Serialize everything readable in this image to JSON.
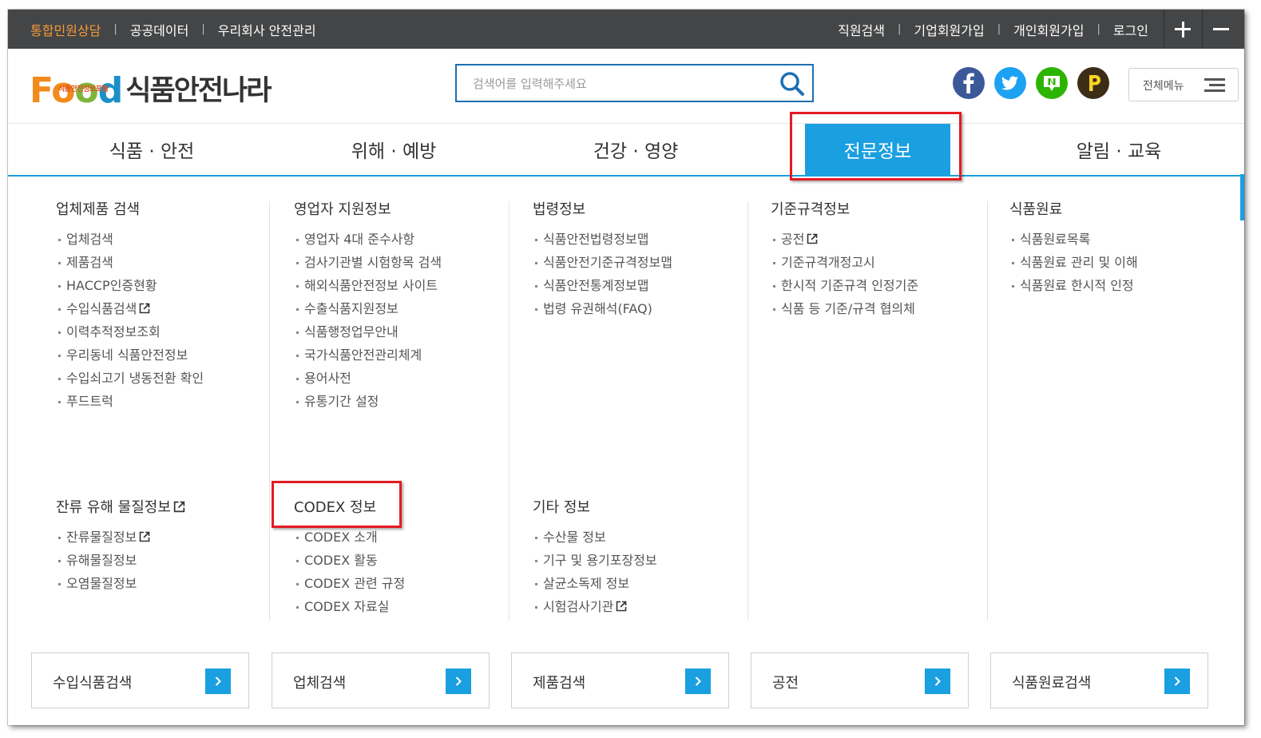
{
  "topbar": {
    "left_links": [
      "통합민원상담",
      "공공데이터",
      "우리회사 안전관리"
    ],
    "right_links": [
      "직원검색",
      "기업회원가입",
      "개인회원가입",
      "로그인"
    ],
    "separator": "|",
    "highlight_color": "#f39a3b"
  },
  "logo": {
    "food_text": "Food",
    "portal_small": "식품안전정보포털",
    "korean": "식품안전나라"
  },
  "search": {
    "placeholder": "검색어를 입력해주세요",
    "value": ""
  },
  "social_icons": [
    "facebook-icon",
    "twitter-icon",
    "naver-blog-icon",
    "kakao-story-icon"
  ],
  "allmenu": {
    "label": "전체메뉴"
  },
  "nav": {
    "items": [
      "식품 · 안전",
      "위해 · 예방",
      "건강 · 영양",
      "전문정보",
      "알림 · 교육"
    ],
    "active_index": 3,
    "accent_color": "#1a9fe0"
  },
  "mega": {
    "col1": {
      "title": "업체제품 검색",
      "items": [
        "업체검색",
        "제품검색",
        "HACCP인증현황",
        "수입식품검색",
        "이력추적정보조회",
        "우리동네 식품안전정보",
        "수입쇠고기 냉동전환 확인",
        "푸드트럭"
      ]
    },
    "col2": {
      "title": "영업자 지원정보",
      "items": [
        "영업자 4대 준수사항",
        "검사기관별 시험항목 검색",
        "해외식품안전정보 사이트",
        "수출식품지원정보",
        "식품행정업무안내",
        "국가식품안전관리체계",
        "용어사전",
        "유통기간 설정"
      ]
    },
    "col3": {
      "title": "법령정보",
      "items": [
        "식품안전법령정보맵",
        "식품안전기준규격정보맵",
        "식품안전통계정보맵",
        "법령 유권해석(FAQ)"
      ]
    },
    "col4": {
      "title": "기준규격정보",
      "items": [
        "공전",
        "기준규격개정고시",
        "한시적 기준규격 인정기준",
        "식품 등 기준/규격 협의체"
      ]
    },
    "col5": {
      "title": "식품원료",
      "items": [
        "식품원료목록",
        "식품원료 관리 및 이해",
        "식품원료 한시적 인정"
      ]
    },
    "col6": {
      "title": "잔류 유해 물질정보",
      "items": [
        "잔류물질정보",
        "유해물질정보",
        "오염물질정보"
      ]
    },
    "col7": {
      "title": "CODEX 정보",
      "items": [
        "CODEX 소개",
        "CODEX 활동",
        "CODEX 관련 규정",
        "CODEX 자료실"
      ]
    },
    "col8": {
      "title": "기타 정보",
      "items": [
        "수산물 정보",
        "기구 및 용기포장정보",
        "살균소독제 정보",
        "시험검사기관"
      ]
    }
  },
  "quick_buttons": [
    "수입식품검색",
    "업체검색",
    "제품검색",
    "공전",
    "식품원료검색"
  ],
  "annotation_color": "#e31b23"
}
